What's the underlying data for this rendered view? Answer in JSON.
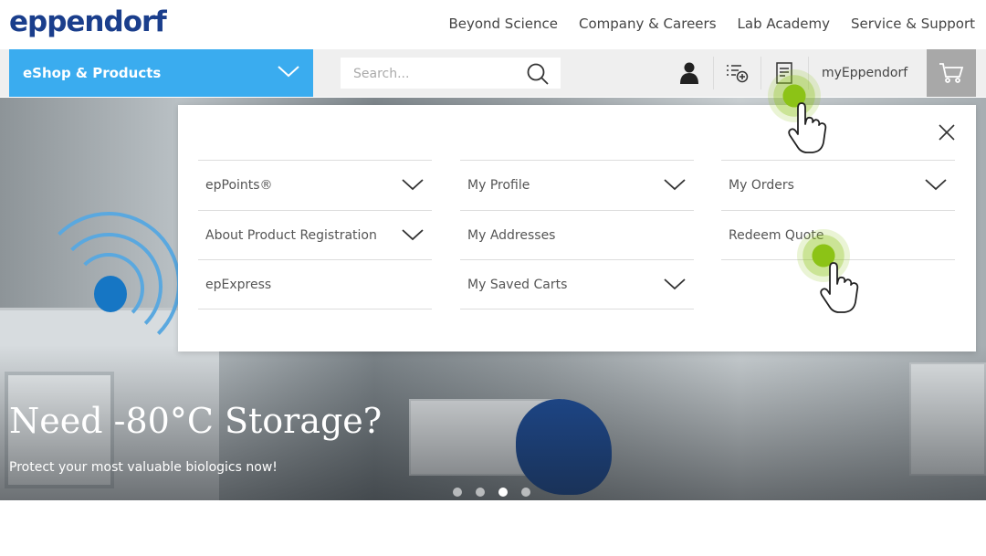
{
  "brand": {
    "logo": "eppendorf"
  },
  "top_nav": [
    "Beyond Science",
    "Company & Careers",
    "Lab Academy",
    "Service & Support"
  ],
  "main_bar": {
    "eshop_label": "eShop & Products",
    "search_placeholder": "Search...",
    "account_label": "myEppendorf"
  },
  "hero": {
    "title": "Need -80°C Storage?",
    "subtitle": "Protect your most valuable biologics now!",
    "carousel_total": 4,
    "carousel_active": 3
  },
  "account_menu": {
    "columns": [
      [
        {
          "label": "epPoints®",
          "expandable": true
        },
        {
          "label": "About Product Registration",
          "expandable": true
        },
        {
          "label": "epExpress",
          "expandable": false
        }
      ],
      [
        {
          "label": "My Profile",
          "expandable": true
        },
        {
          "label": "My Addresses",
          "expandable": false
        },
        {
          "label": "My Saved Carts",
          "expandable": true
        }
      ],
      [
        {
          "label": "My Orders",
          "expandable": true
        },
        {
          "label": "Redeem Quote",
          "expandable": false
        }
      ]
    ]
  },
  "colors": {
    "brand_blue": "#1a3e8c",
    "eshop_blue": "#3aacef",
    "hotspot_green": "#8cc316",
    "cart_gray": "#a8a8a8"
  }
}
